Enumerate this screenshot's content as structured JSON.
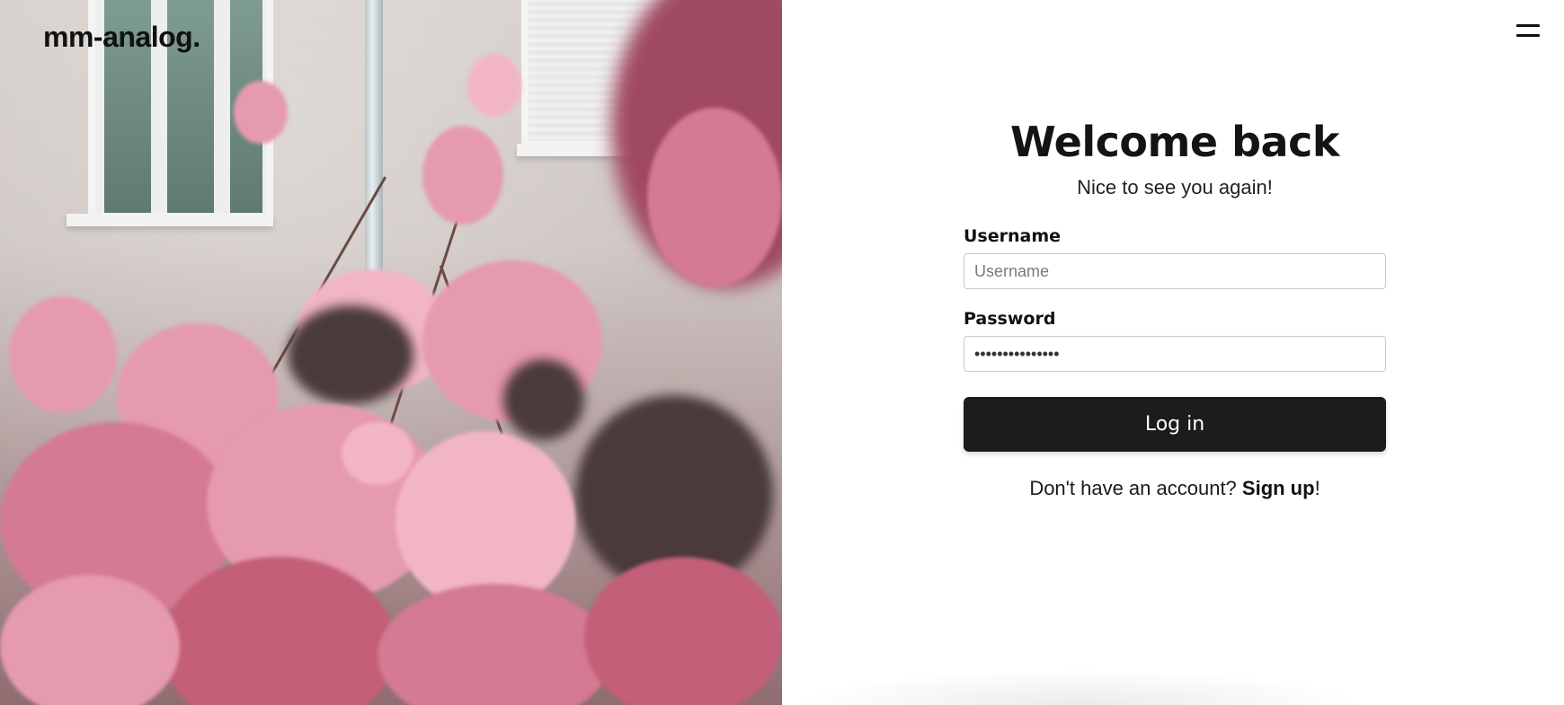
{
  "brand": {
    "logo_text": "mm-analog."
  },
  "header": {
    "menu_icon": "hamburger-menu-icon"
  },
  "login": {
    "title": "Welcome back",
    "subtitle": "Nice to see you again!",
    "username": {
      "label": "Username",
      "placeholder": "Username",
      "value": ""
    },
    "password": {
      "label": "Password",
      "placeholder": "",
      "value": "•••••••••••••••"
    },
    "submit_label": "Log in",
    "signup_prefix": "Don't have an account? ",
    "signup_link": "Sign up",
    "signup_suffix": "!"
  },
  "colors": {
    "button_bg": "#1c1c1c",
    "button_text": "#ffffff",
    "input_border": "#c8c8c8",
    "blossom_pink": "#e69aae"
  }
}
